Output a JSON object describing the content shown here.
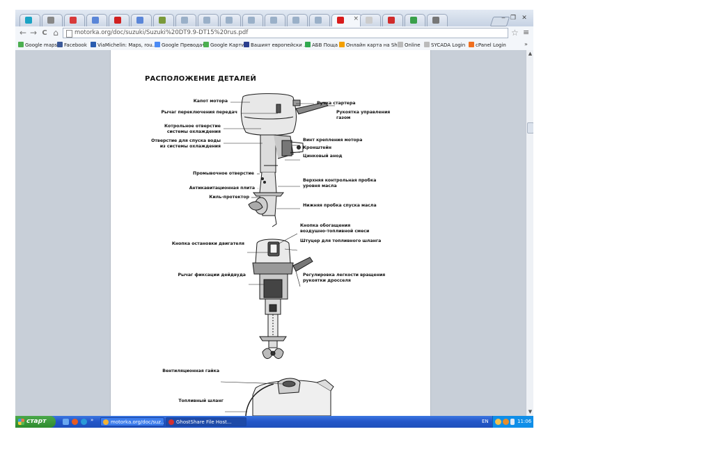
{
  "browser": {
    "tab_icon_colors": [
      "#1aa3c4",
      "#888888",
      "#d83a3a",
      "#5a86d8",
      "#d02020",
      "#5a86d8",
      "#7a9a3a",
      "#9ab0c8",
      "#9ab0c8",
      "#9ab0c8",
      "#9ab0c8",
      "#9ab0c8",
      "#9ab0c8",
      "#9ab0c8",
      "#d81b1b",
      "#cccccc",
      "#d02b2b",
      "#3aa04a",
      "#777777"
    ],
    "active_tab_close": "×",
    "window_controls": {
      "minimize": "‒",
      "restore": "❐",
      "close": "✕"
    },
    "nav": {
      "back": "←",
      "forward": "→",
      "reload": "C",
      "home": "⌂"
    },
    "url": "motorka.org/doc/suzuki/Suzuki%20DT9.9-DT15%20rus.pdf",
    "bookmark_star": "☆",
    "menu_icon": "≡",
    "bookmarks": [
      {
        "label": "Google maps",
        "color": "#4caf50"
      },
      {
        "label": "Facebook",
        "color": "#3b5998"
      },
      {
        "label": "ViaMichelin: Maps, rou...",
        "color": "#2a5db0"
      },
      {
        "label": "Google Преводач",
        "color": "#4a8af4"
      },
      {
        "label": "Google Карти",
        "color": "#4caf50"
      },
      {
        "label": "Вашият европейски ...",
        "color": "#2a3f8f"
      },
      {
        "label": "АБВ Поща",
        "color": "#2fa84f"
      },
      {
        "label": "Онлайн карта на Shell",
        "color": "#f4a000"
      },
      {
        "label": "Online",
        "color": "#bbbbbb"
      },
      {
        "label": "SYCADA Login",
        "color": "#bbbbbb"
      },
      {
        "label": "cPanel Login",
        "color": "#f07020"
      }
    ],
    "bookmarks_more": "»"
  },
  "document": {
    "title": "РАСПОЛОЖЕНИЕ ДЕТАЛЕЙ",
    "labels_left_1": [
      "Капот мотора",
      "Рычаг переключения передач",
      "Котрольное отверстие\nсистемы охлаждения",
      "Отверстие для спуска воды\nиз системы охлаждения",
      "Промывочное отверстие",
      "Антикавитационная плита",
      "Киль-протектор"
    ],
    "labels_right_1": [
      "Ручка стартера",
      "Рукоятка управления\nгазом",
      "Винт крепления мотора",
      "Кронштейн",
      "Цинковый анод",
      "Верхняя контрольная пробка\nуровня масла",
      "Нижняя пробка спуска масла"
    ],
    "labels_left_2": [
      "Кнопка остановки двигателя",
      "Рычаг фиксации дейдвуда"
    ],
    "labels_right_2": [
      "Кнопка обогащения\nвоздушно-топливной смеси",
      "Штуцер для топливного шланга",
      "Регулировка легкости вращения\nрукоятки дросселя"
    ],
    "labels_left_3": [
      "Вентиляционная гайка",
      "Топливный шланг"
    ]
  },
  "scrollbar": {
    "up": "▲",
    "down": "▼"
  },
  "taskbar": {
    "start_label": "старт",
    "quicklaunch_colors": [
      "#6aa8f0",
      "#e85a20",
      "#2a9ad8"
    ],
    "quicklaunch_more": "»",
    "tasks": [
      {
        "label": "motorka.org/doc/suz...",
        "color": "#f2b233"
      },
      {
        "label": "GhostShare File Host...",
        "color": "#d43030"
      }
    ],
    "language": "EN",
    "clock": "11:06"
  }
}
